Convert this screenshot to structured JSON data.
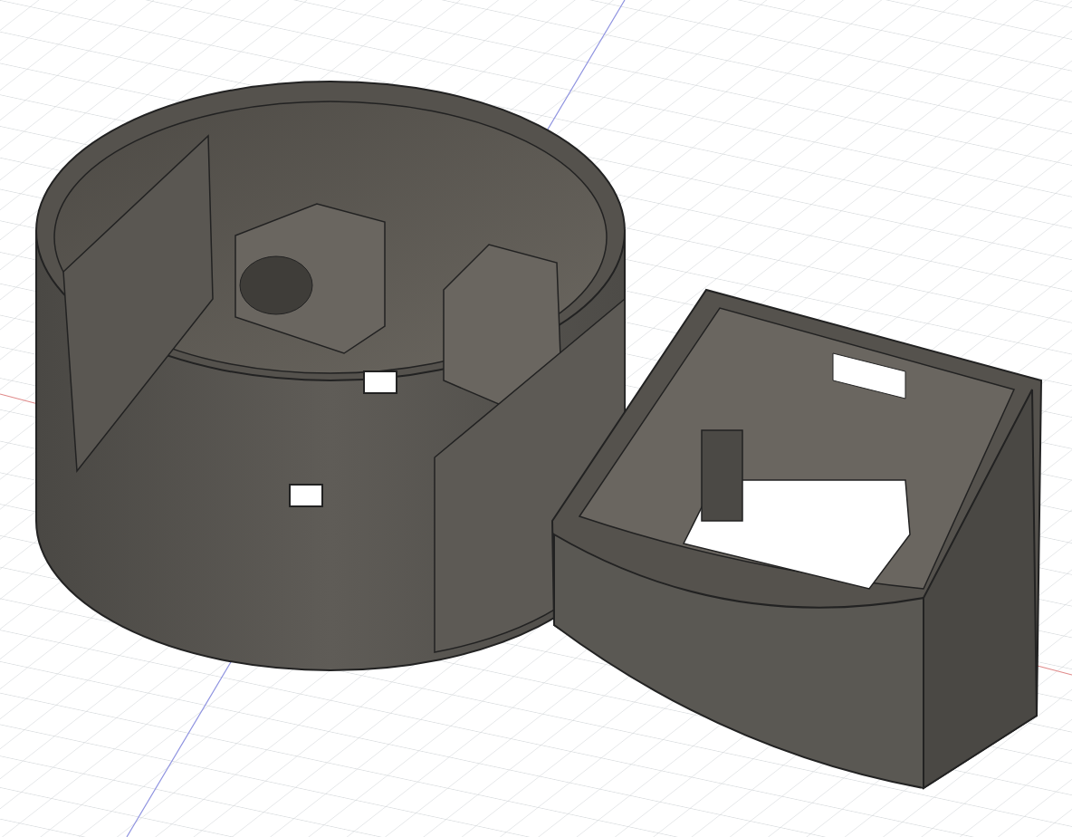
{
  "viewport": {
    "grid_visible": true,
    "models": [
      {
        "kind": "round-housing"
      },
      {
        "kind": "box-housing"
      }
    ]
  }
}
